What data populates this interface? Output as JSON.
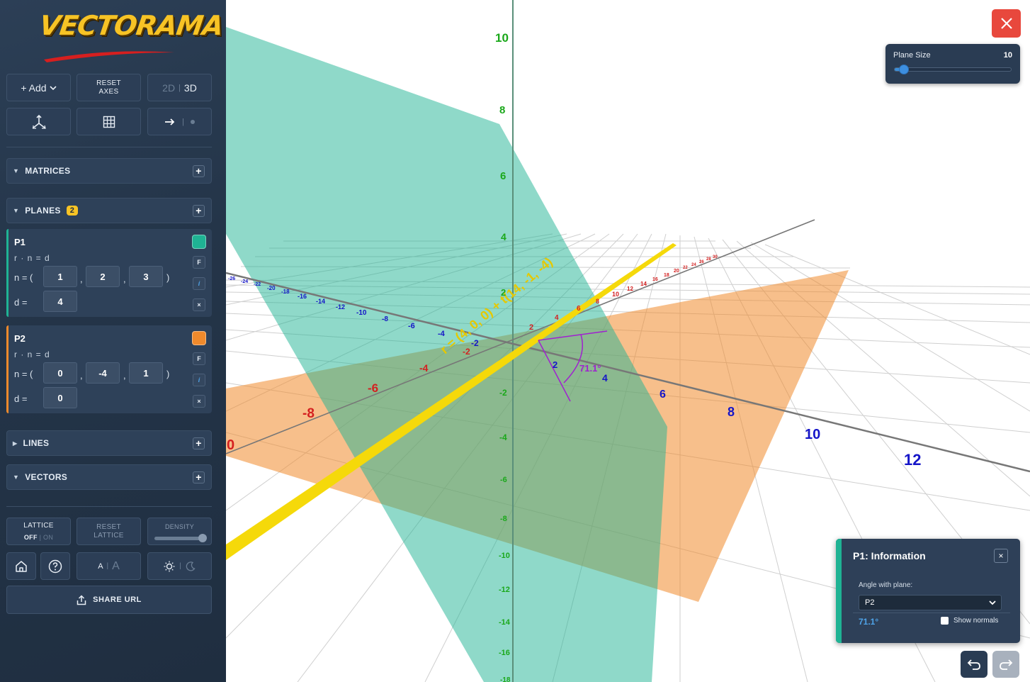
{
  "app": {
    "title": "VECTORAMA"
  },
  "toolbar": {
    "add_label": "+ Add",
    "reset_axes_line1": "RESET",
    "reset_axes_line2": "AXES",
    "mode_2d": "2D",
    "mode_sep": "|",
    "mode_3d": "3D"
  },
  "sections": {
    "matrices": "MATRICES",
    "planes": "PLANES",
    "planes_count": "2",
    "lines": "LINES",
    "vectors": "VECTORS"
  },
  "planes": [
    {
      "name": "P1",
      "form": "r · n = d",
      "n_label": "n = (",
      "n": [
        "1",
        "2",
        "3"
      ],
      "close": ")",
      "d_label": "d =",
      "d": "4",
      "color": "#1fb394",
      "f_label": "F",
      "i_label": "i",
      "x_label": "×"
    },
    {
      "name": "P2",
      "form": "r · n = d",
      "n_label": "n = (",
      "n": [
        "0",
        "-4",
        "1"
      ],
      "close": ")",
      "d_label": "d =",
      "d": "0",
      "color": "#f08a2c",
      "f_label": "F",
      "i_label": "i",
      "x_label": "×"
    }
  ],
  "bottom_controls": {
    "lattice_label": "LATTICE",
    "lattice_off": "OFF",
    "lattice_on": "ON",
    "reset_lattice_1": "RESET",
    "reset_lattice_2": "LATTICE",
    "density_label": "DENSITY",
    "font_small": "A",
    "font_large": "A",
    "share_label": "SHARE URL"
  },
  "plane_size": {
    "label": "Plane Size",
    "value": "10",
    "fraction": 0.08
  },
  "info_panel": {
    "title": "P1: Information",
    "close": "×",
    "angle_label": "Angle with plane:",
    "selected_plane": "P2",
    "angle_value": "71.1°",
    "show_normals_label": "Show normals"
  },
  "scene": {
    "line_label": "r = (4, 0, 0) + t(14, -1, -4)",
    "angle_label": "71.1°",
    "y_ticks": [
      "10",
      "8",
      "6",
      "4",
      "2",
      "-2",
      "-4",
      "-6",
      "-8",
      "-10",
      "-12",
      "-14",
      "-16",
      "-18"
    ],
    "x_axis_labels_big": [
      "-8",
      "-6",
      "-4",
      "-2",
      "0"
    ],
    "x_axis_labels_small": [
      "2",
      "4",
      "6",
      "8",
      "10",
      "12",
      "14",
      "16",
      "18",
      "20",
      "22",
      "24",
      "26",
      "28",
      "30"
    ],
    "z_axis_labels_big": [
      "4",
      "6",
      "8",
      "10",
      "12"
    ],
    "z_axis_labels_small": [
      "-26",
      "-24",
      "-22",
      "-20",
      "-18",
      "-16",
      "-14",
      "-12",
      "-10",
      "-8",
      "-6",
      "-4",
      "-2"
    ],
    "angle_marker_num": "2",
    "colors": {
      "y_axis": "#1aa81a",
      "x_axis": "#d42020",
      "z_axis": "#1515c8",
      "plane_p1": "#1fb394",
      "plane_p2": "#f08a2c",
      "line": "#f5d90a",
      "angle": "#a020d0"
    }
  }
}
